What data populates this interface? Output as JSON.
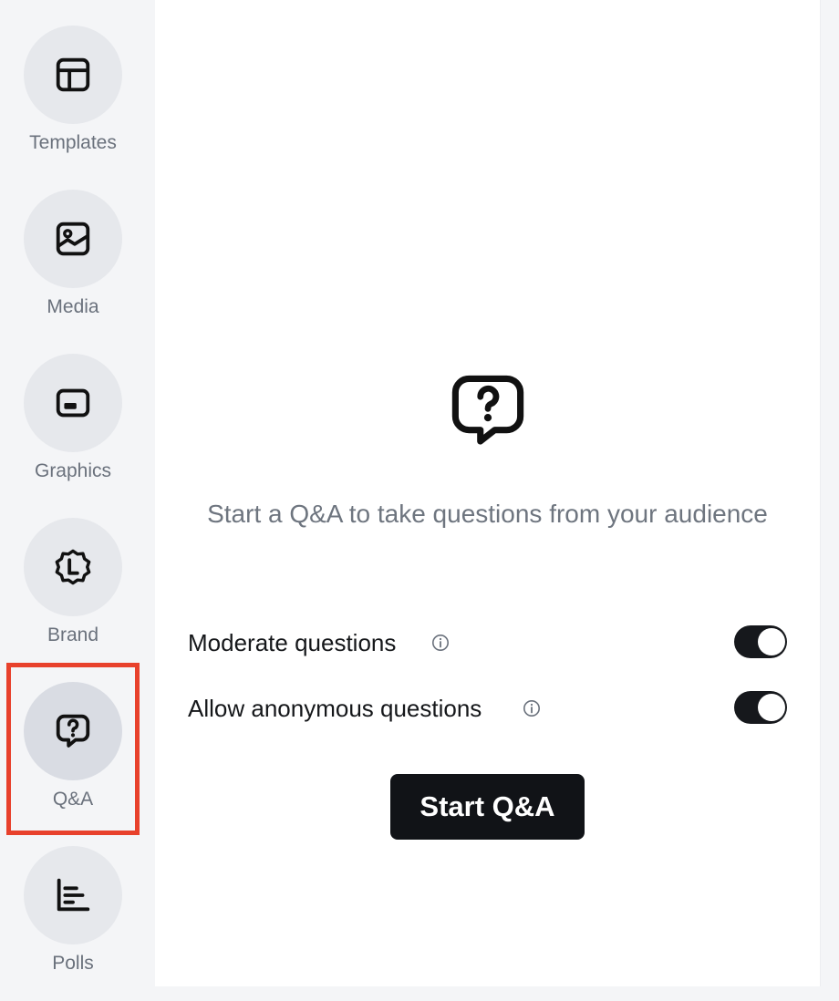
{
  "sidebar": {
    "items": [
      {
        "label": "Templates",
        "icon": "layout-icon",
        "active": false
      },
      {
        "label": "Media",
        "icon": "image-icon",
        "active": false
      },
      {
        "label": "Graphics",
        "icon": "lower-third-icon",
        "active": false
      },
      {
        "label": "Brand",
        "icon": "brand-badge-icon",
        "active": false
      },
      {
        "label": "Q&A",
        "icon": "question-bubble-icon",
        "active": true
      },
      {
        "label": "Polls",
        "icon": "poll-chart-icon",
        "active": false
      }
    ]
  },
  "main": {
    "hero_icon": "question-bubble-icon",
    "description": "Start a Q&A to take questions from your audience",
    "options": [
      {
        "label": "Moderate questions",
        "enabled": true
      },
      {
        "label": "Allow anonymous questions",
        "enabled": true
      }
    ],
    "start_button_label": "Start Q&A"
  },
  "colors": {
    "highlight": "#e8412c",
    "button_bg": "#111317",
    "sidebar_bg": "#f4f5f7"
  }
}
